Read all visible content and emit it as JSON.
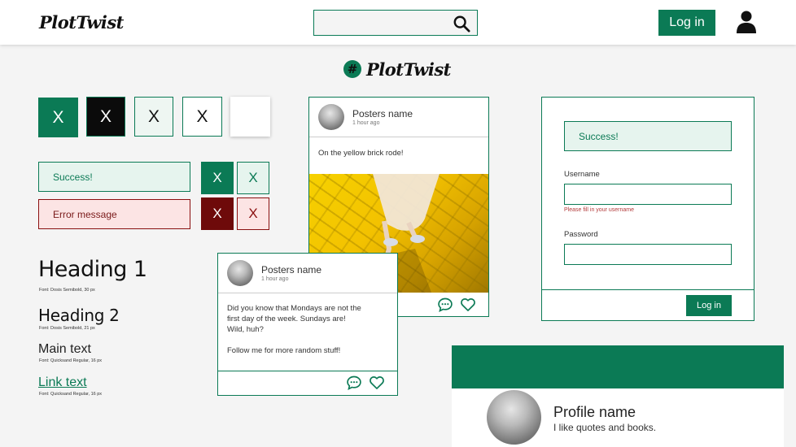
{
  "app": {
    "name": "PlotTwist"
  },
  "header": {
    "logo": "PlotTwist",
    "search": {
      "value": "",
      "placeholder": "",
      "icon": "search-icon"
    },
    "login_label": "Log in",
    "user_icon": "user-icon"
  },
  "center_logo": {
    "hash": "#",
    "text": "PlotTwist"
  },
  "x_buttons": {
    "label": "X"
  },
  "alerts": {
    "success": "Success!",
    "error": "Error message"
  },
  "typography": {
    "heading1": "Heading 1",
    "heading1_font": "Font: Dosis Semibold, 30 px",
    "heading2": "Heading 2",
    "heading2_font": "Font: Dosis Semibold, 21 px",
    "main_text": "Main text",
    "main_text_font": "Font: Quicksand Regular, 16 px",
    "link_text": "Link text",
    "link_text_font": "Font: Quicksand Regular, 16 px"
  },
  "post_image": {
    "poster_name": "Posters name",
    "time": "1 hour ago",
    "text": "On the yellow brick rode!"
  },
  "post_text": {
    "poster_name": "Posters name",
    "time": "1 hour ago",
    "line1": "Did you know that Mondays are not the",
    "line2": "first day of the week. Sundays are!",
    "line3": "Wild, huh?",
    "line4": "Follow me for more random stuff!"
  },
  "login_form": {
    "success": "Success!",
    "username_label": "Username",
    "username_value": "",
    "username_hint": "Please fill in your username",
    "password_label": "Password",
    "password_value": "",
    "submit_label": "Log in"
  },
  "profile": {
    "name": "Profile name",
    "bio": "I like quotes and books."
  },
  "colors": {
    "primary": "#0b7a55",
    "dark": "#111111",
    "danger": "#6e0a0a",
    "success_bg": "#e6f4ee",
    "error_bg": "#fce4e4"
  }
}
